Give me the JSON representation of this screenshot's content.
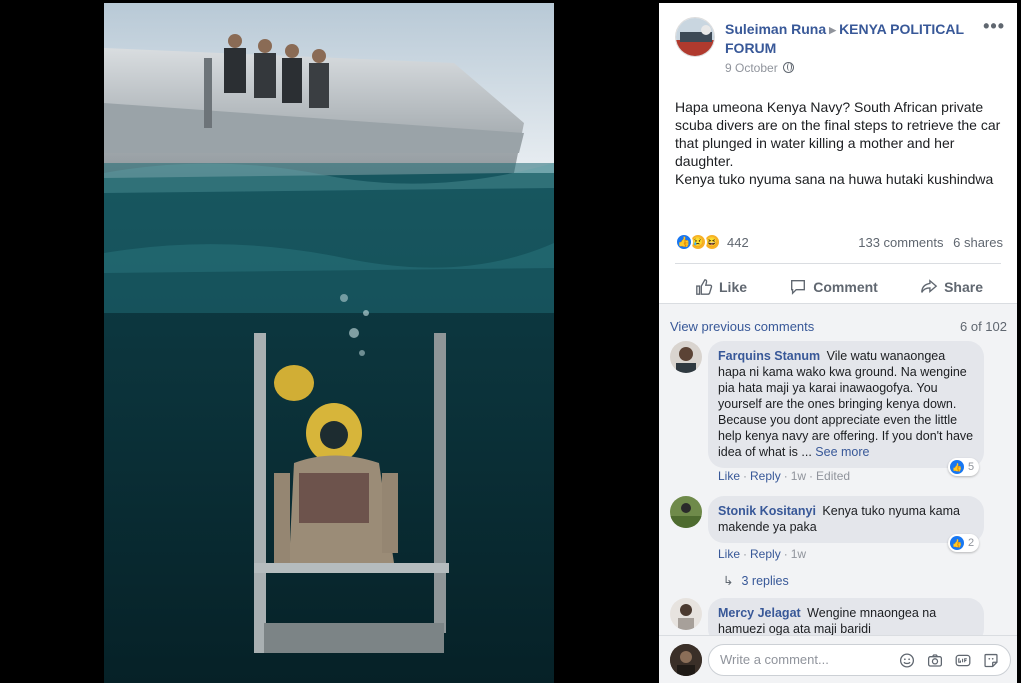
{
  "post": {
    "author": "Suleiman Runa",
    "group": "KENYA POLITICAL FORUM",
    "date": "9 October",
    "text_lines": [
      "Hapa umeona Kenya Navy? South African private scuba divers are on the final steps to retrieve the car that plunged in water killing a mother and her daughter.",
      "Kenya tuko nyuma sana na huwa hutaki kushindwa"
    ],
    "reaction_count": "442",
    "comments_count": "133 comments",
    "shares_count": "6 shares",
    "reaction_icons": [
      "like-icon",
      "sad-icon",
      "haha-icon"
    ]
  },
  "actions": {
    "like": "Like",
    "comment": "Comment",
    "share": "Share"
  },
  "comments_section": {
    "view_previous": "View previous comments",
    "position": "6 of 102",
    "replies_link": "3 replies",
    "items": [
      {
        "name": "Farquins Stanum",
        "text": "Vile watu wanaongea hapa ni kama wako kwa ground. Na wengine pia hata maji ya karai inawaogofya. You yourself are the ones bringing kenya down. Because you dont appreciate even the little help kenya navy are offering. If you don't have idea of what is ...",
        "see_more": "See more",
        "like": "Like",
        "reply": "Reply",
        "age": "1w",
        "edited": "Edited",
        "reactions": "5"
      },
      {
        "name": "Stonik Kositanyi",
        "text": "Kenya tuko nyuma kama makende ya paka",
        "like": "Like",
        "reply": "Reply",
        "age": "1w",
        "reactions": "2"
      },
      {
        "name": "Mercy Jelagat",
        "text": "Wengine mnaongea na hamuezi oga ata maji baridi"
      }
    ]
  },
  "composer": {
    "placeholder": "Write a comment...",
    "icons": [
      "emoji-icon",
      "camera-icon",
      "gif-icon",
      "sticker-icon"
    ]
  },
  "colors": {
    "link_blue": "#385898",
    "like_blue": "#1877f2",
    "muted": "#90949c",
    "comment_bg": "#f2f3f5",
    "bubble_bg": "#e4e6eb"
  }
}
